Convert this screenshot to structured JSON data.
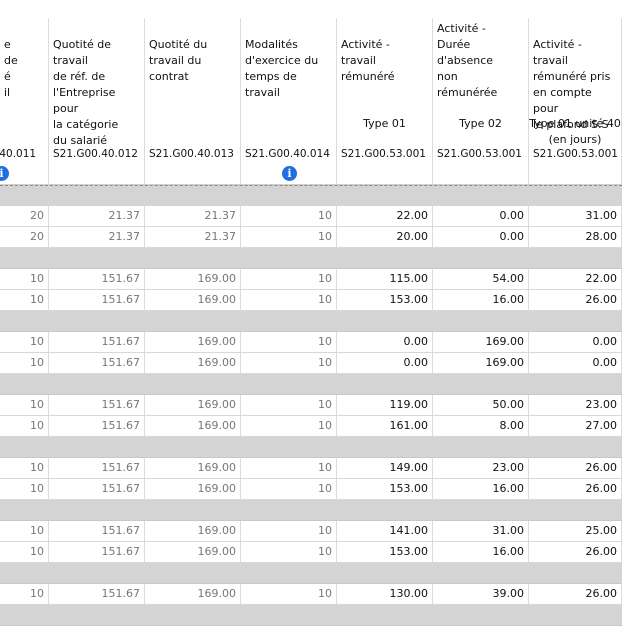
{
  "columns": [
    {
      "title": "e\nde\né\nil",
      "type": "",
      "code": ".40.011",
      "info": true
    },
    {
      "title": "Quotité de\ntravail\nde réf. de\nl'Entreprise pour\nla catégorie\ndu salarié",
      "type": "",
      "code": "S21.G00.40.012",
      "info": false
    },
    {
      "title": "Quotité du\ntravail du\ncontrat",
      "type": "",
      "code": "S21.G00.40.013",
      "info": false
    },
    {
      "title": "Modalités\nd'exercice du\ntemps de\ntravail",
      "type": "",
      "code": "S21.G00.40.014",
      "info": true
    },
    {
      "title": "Activité -\ntravail\nrémunéré",
      "type": "Type 01",
      "code": "S21.G00.53.001",
      "info": false
    },
    {
      "title": "Activité -\nDurée\nd'absence\nnon\nrémunérée",
      "type": "Type 02",
      "code": "S21.G00.53.001",
      "info": false
    },
    {
      "title": "Activité - travail\nrémunéré pris\nen compte pour\nle plafond S.S",
      "type": "Type 01 unité 40\n(en jours)",
      "code": "S21.G00.53.001",
      "info": false
    }
  ],
  "rows": [
    {
      "gray": false,
      "cells": [
        "20",
        "21.37",
        "21.37",
        "10",
        "22.00",
        "0.00",
        "31.00"
      ]
    },
    {
      "gray": false,
      "cells": [
        "20",
        "21.37",
        "21.37",
        "10",
        "20.00",
        "0.00",
        "28.00"
      ]
    },
    {
      "gray": true,
      "cells": []
    },
    {
      "gray": false,
      "cells": [
        "10",
        "151.67",
        "169.00",
        "10",
        "115.00",
        "54.00",
        "22.00"
      ]
    },
    {
      "gray": false,
      "cells": [
        "10",
        "151.67",
        "169.00",
        "10",
        "153.00",
        "16.00",
        "26.00"
      ]
    },
    {
      "gray": true,
      "cells": []
    },
    {
      "gray": false,
      "cells": [
        "10",
        "151.67",
        "169.00",
        "10",
        "0.00",
        "169.00",
        "0.00"
      ]
    },
    {
      "gray": false,
      "cells": [
        "10",
        "151.67",
        "169.00",
        "10",
        "0.00",
        "169.00",
        "0.00"
      ]
    },
    {
      "gray": true,
      "cells": []
    },
    {
      "gray": false,
      "cells": [
        "10",
        "151.67",
        "169.00",
        "10",
        "119.00",
        "50.00",
        "23.00"
      ]
    },
    {
      "gray": false,
      "cells": [
        "10",
        "151.67",
        "169.00",
        "10",
        "161.00",
        "8.00",
        "27.00"
      ]
    },
    {
      "gray": true,
      "cells": []
    },
    {
      "gray": false,
      "cells": [
        "10",
        "151.67",
        "169.00",
        "10",
        "149.00",
        "23.00",
        "26.00"
      ]
    },
    {
      "gray": false,
      "cells": [
        "10",
        "151.67",
        "169.00",
        "10",
        "153.00",
        "16.00",
        "26.00"
      ]
    },
    {
      "gray": true,
      "cells": []
    },
    {
      "gray": false,
      "cells": [
        "10",
        "151.67",
        "169.00",
        "10",
        "141.00",
        "31.00",
        "25.00"
      ]
    },
    {
      "gray": false,
      "cells": [
        "10",
        "151.67",
        "169.00",
        "10",
        "153.00",
        "16.00",
        "26.00"
      ]
    },
    {
      "gray": true,
      "cells": []
    },
    {
      "gray": false,
      "cells": [
        "10",
        "151.67",
        "169.00",
        "10",
        "130.00",
        "39.00",
        "26.00"
      ]
    },
    {
      "gray": true,
      "cells": []
    }
  ]
}
